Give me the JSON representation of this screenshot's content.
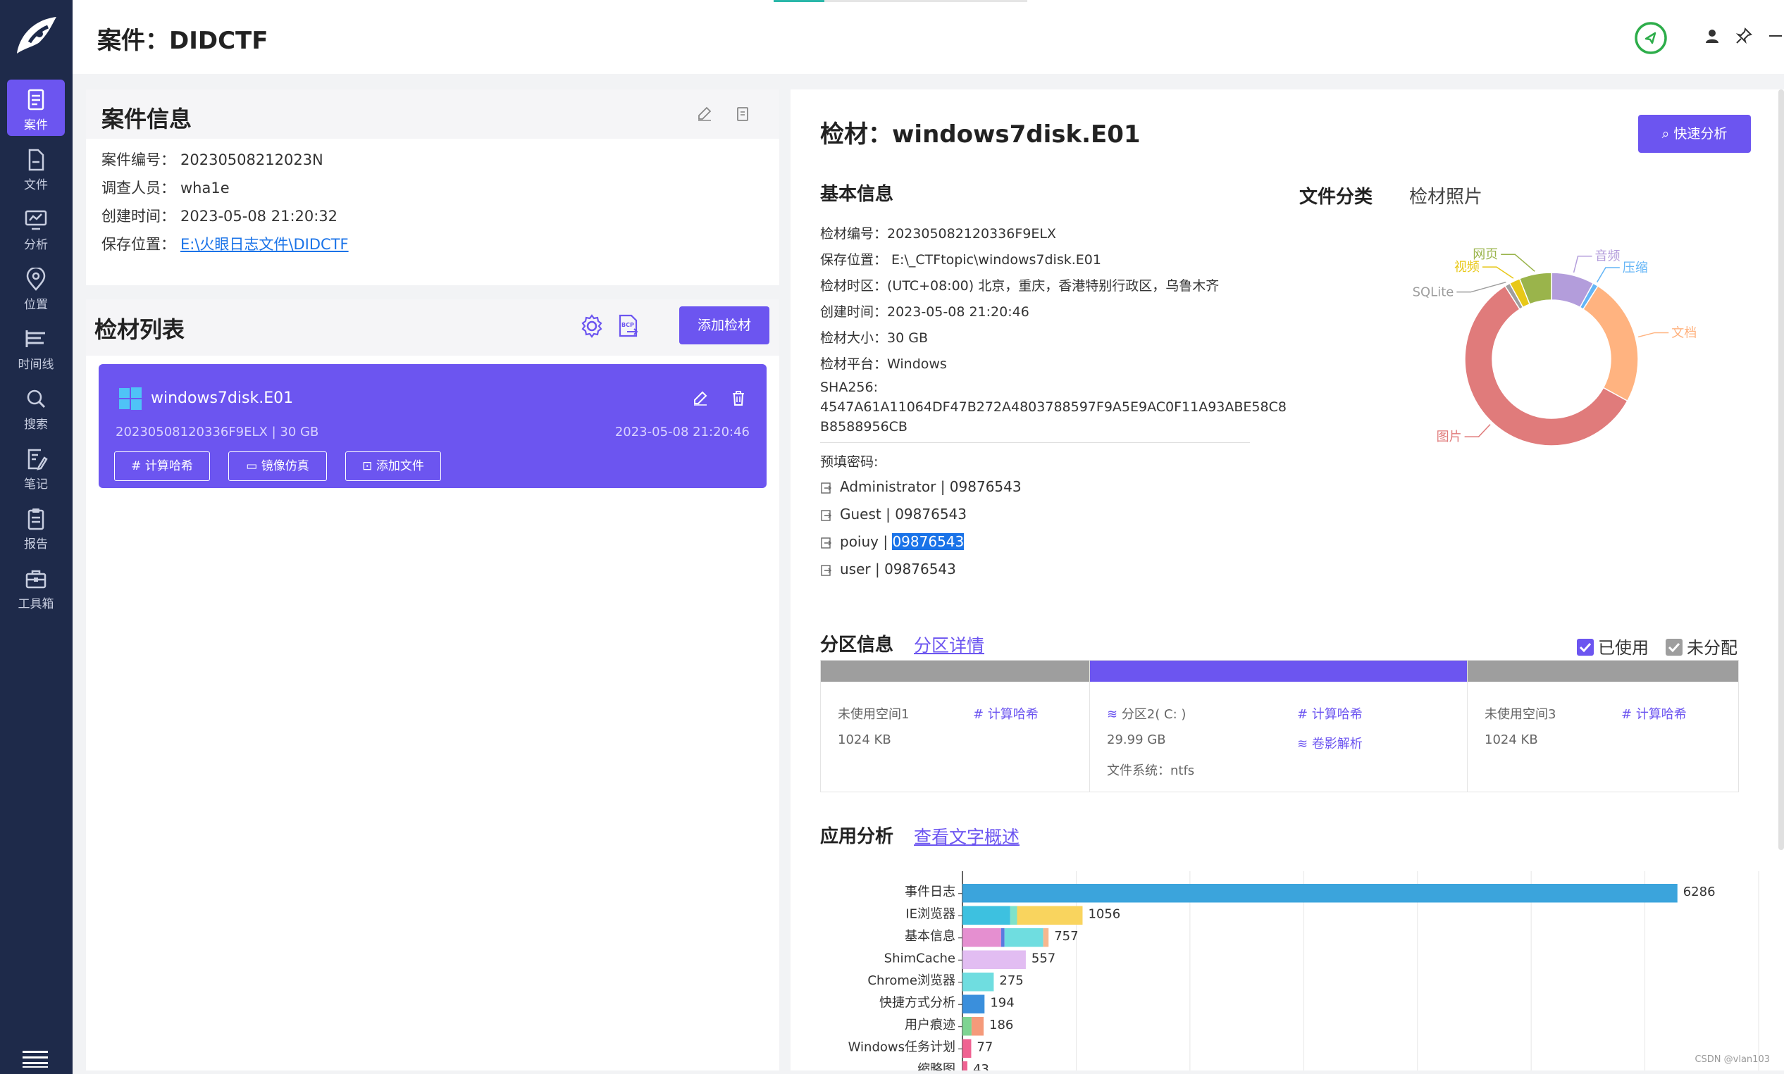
{
  "sidebar": {
    "items": [
      {
        "label": "案件",
        "icon": "case-icon",
        "active": true
      },
      {
        "label": "文件",
        "icon": "file-icon"
      },
      {
        "label": "分析",
        "icon": "analysis-icon"
      },
      {
        "label": "位置",
        "icon": "location-icon"
      },
      {
        "label": "时间线",
        "icon": "timeline-icon"
      },
      {
        "label": "搜索",
        "icon": "search-icon"
      },
      {
        "label": "笔记",
        "icon": "note-icon"
      },
      {
        "label": "报告",
        "icon": "report-icon"
      },
      {
        "label": "工具箱",
        "icon": "toolbox-icon"
      }
    ]
  },
  "header": {
    "title": "案件：DIDCTF"
  },
  "case_info": {
    "title": "案件信息",
    "number_label": "案件编号：",
    "number": "20230508212023N",
    "investigator_label": "调查人员：",
    "investigator": "wha1e",
    "created_label": "创建时间：",
    "created": "2023-05-08 21:20:32",
    "location_label": "保存位置：",
    "location": "E:\\火眼日志文件\\DIDCTF"
  },
  "evidence_list": {
    "title": "检材列表",
    "add_button": "添加检材",
    "items": [
      {
        "name": "windows7disk.E01",
        "meta": "20230508120336F9ELX | 30 GB",
        "time": "2023-05-08 21:20:46",
        "btn_hash": "计算哈希",
        "btn_mirror": "镜像仿真",
        "btn_add_file": "添加文件"
      }
    ]
  },
  "evidence_detail": {
    "title": "检材：windows7disk.E01",
    "quick_analysis": "快速分析",
    "basic_title": "基本信息",
    "basic": [
      "检材编号：202305082120336F9ELX",
      "保存位置：  E:\\_CTFtopic\\windows7disk.E01",
      "检材时区：(UTC+08:00) 北京，重庆，香港特别行政区，乌鲁木齐",
      "创建时间：2023-05-08 21:20:46",
      "检材大小：30 GB",
      "检材平台：Windows"
    ],
    "sha_label": "SHA256:",
    "sha_line1": "4547A61A11064DF47B272A4803788597F9A5E9AC0F11A93ABE58C8",
    "sha_line2": "B8588956CB",
    "pw_label": "预填密码:",
    "passwords": [
      {
        "user": "Administrator",
        "pw": "09876543",
        "selected": false
      },
      {
        "user": "Guest",
        "pw": "09876543",
        "selected": false
      },
      {
        "user": "poiuy",
        "pw": "09876543",
        "selected": true
      },
      {
        "user": "user",
        "pw": "09876543",
        "selected": false
      }
    ],
    "tab_file_class": "文件分类",
    "tab_photo": "检材照片"
  },
  "donut": {
    "slices": [
      {
        "name": "音频",
        "value": 8,
        "color": "#b39ddb"
      },
      {
        "name": "压缩",
        "value": 1,
        "color": "#64b5f6"
      },
      {
        "name": "文档",
        "value": 24,
        "color": "#ffb380"
      },
      {
        "name": "图片",
        "value": 58,
        "color": "#e07b7b"
      },
      {
        "name": "SQLite",
        "value": 1,
        "color": "#9e9e9e"
      },
      {
        "name": "视频",
        "value": 2,
        "color": "#e8c817"
      },
      {
        "name": "网页",
        "value": 6,
        "color": "#9ab44b"
      }
    ]
  },
  "partitions": {
    "title": "分区信息",
    "detail_link": "分区详情",
    "used_label": "已使用",
    "unalloc_label": "未分配",
    "items": [
      {
        "name": "未使用空间1",
        "size": "1024 KB",
        "action": "计算哈希",
        "bar_color": "#9e9e9e"
      },
      {
        "name": "分区2( C: )",
        "size": "29.99 GB",
        "fs": "文件系统：ntfs",
        "action": "计算哈希",
        "action2": "卷影解析",
        "bar_color": "#6c55f0"
      },
      {
        "name": "未使用空间3",
        "size": "1024 KB",
        "action": "计算哈希",
        "bar_color": "#9e9e9e"
      }
    ]
  },
  "app_analysis": {
    "title": "应用分析",
    "summary_link": "查看文字概述"
  },
  "chart_data": {
    "type": "bar",
    "orientation": "horizontal",
    "stacked": true,
    "categories": [
      "事件日志",
      "IE浏览器",
      "基本信息",
      "ShimCache",
      "Chrome浏览器",
      "快捷方式分析",
      "用户痕迹",
      "Windows任务计划",
      "缩略图"
    ],
    "totals": [
      6286,
      1056,
      757,
      557,
      275,
      194,
      186,
      77,
      43
    ],
    "segments": [
      [
        {
          "v": 6286,
          "c": "#3ba4dc"
        }
      ],
      [
        {
          "v": 420,
          "c": "#3dc1e0"
        },
        {
          "v": 60,
          "c": "#7ee2c9"
        },
        {
          "v": 576,
          "c": "#f9d45e"
        }
      ],
      [
        {
          "v": 340,
          "c": "#e58fd0"
        },
        {
          "v": 30,
          "c": "#5a7ae0"
        },
        {
          "v": 340,
          "c": "#6fdde0"
        },
        {
          "v": 47,
          "c": "#f6b78e"
        }
      ],
      [
        {
          "v": 557,
          "c": "#e2bdf2"
        }
      ],
      [
        {
          "v": 275,
          "c": "#6fdde0"
        }
      ],
      [
        {
          "v": 194,
          "c": "#3a8fdc"
        }
      ],
      [
        {
          "v": 80,
          "c": "#7ed492"
        },
        {
          "v": 106,
          "c": "#f59a7a"
        }
      ],
      [
        {
          "v": 77,
          "c": "#f06292"
        }
      ],
      [
        {
          "v": 43,
          "c": "#f06292"
        }
      ]
    ],
    "xlim": [
      0,
      7000
    ]
  },
  "watermark": "CSDN @vlan103"
}
